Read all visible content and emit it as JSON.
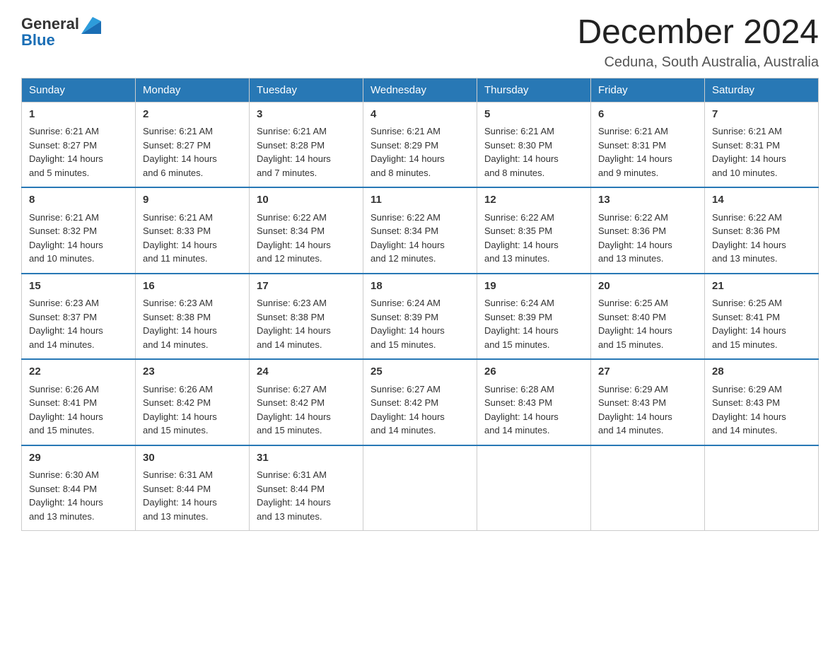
{
  "header": {
    "logo_general": "General",
    "logo_blue": "Blue",
    "month_title": "December 2024",
    "location": "Ceduna, South Australia, Australia"
  },
  "days_of_week": [
    "Sunday",
    "Monday",
    "Tuesday",
    "Wednesday",
    "Thursday",
    "Friday",
    "Saturday"
  ],
  "weeks": [
    [
      {
        "day": "1",
        "sunrise": "6:21 AM",
        "sunset": "8:27 PM",
        "daylight": "14 hours and 5 minutes."
      },
      {
        "day": "2",
        "sunrise": "6:21 AM",
        "sunset": "8:27 PM",
        "daylight": "14 hours and 6 minutes."
      },
      {
        "day": "3",
        "sunrise": "6:21 AM",
        "sunset": "8:28 PM",
        "daylight": "14 hours and 7 minutes."
      },
      {
        "day": "4",
        "sunrise": "6:21 AM",
        "sunset": "8:29 PM",
        "daylight": "14 hours and 8 minutes."
      },
      {
        "day": "5",
        "sunrise": "6:21 AM",
        "sunset": "8:30 PM",
        "daylight": "14 hours and 8 minutes."
      },
      {
        "day": "6",
        "sunrise": "6:21 AM",
        "sunset": "8:31 PM",
        "daylight": "14 hours and 9 minutes."
      },
      {
        "day": "7",
        "sunrise": "6:21 AM",
        "sunset": "8:31 PM",
        "daylight": "14 hours and 10 minutes."
      }
    ],
    [
      {
        "day": "8",
        "sunrise": "6:21 AM",
        "sunset": "8:32 PM",
        "daylight": "14 hours and 10 minutes."
      },
      {
        "day": "9",
        "sunrise": "6:21 AM",
        "sunset": "8:33 PM",
        "daylight": "14 hours and 11 minutes."
      },
      {
        "day": "10",
        "sunrise": "6:22 AM",
        "sunset": "8:34 PM",
        "daylight": "14 hours and 12 minutes."
      },
      {
        "day": "11",
        "sunrise": "6:22 AM",
        "sunset": "8:34 PM",
        "daylight": "14 hours and 12 minutes."
      },
      {
        "day": "12",
        "sunrise": "6:22 AM",
        "sunset": "8:35 PM",
        "daylight": "14 hours and 13 minutes."
      },
      {
        "day": "13",
        "sunrise": "6:22 AM",
        "sunset": "8:36 PM",
        "daylight": "14 hours and 13 minutes."
      },
      {
        "day": "14",
        "sunrise": "6:22 AM",
        "sunset": "8:36 PM",
        "daylight": "14 hours and 13 minutes."
      }
    ],
    [
      {
        "day": "15",
        "sunrise": "6:23 AM",
        "sunset": "8:37 PM",
        "daylight": "14 hours and 14 minutes."
      },
      {
        "day": "16",
        "sunrise": "6:23 AM",
        "sunset": "8:38 PM",
        "daylight": "14 hours and 14 minutes."
      },
      {
        "day": "17",
        "sunrise": "6:23 AM",
        "sunset": "8:38 PM",
        "daylight": "14 hours and 14 minutes."
      },
      {
        "day": "18",
        "sunrise": "6:24 AM",
        "sunset": "8:39 PM",
        "daylight": "14 hours and 15 minutes."
      },
      {
        "day": "19",
        "sunrise": "6:24 AM",
        "sunset": "8:39 PM",
        "daylight": "14 hours and 15 minutes."
      },
      {
        "day": "20",
        "sunrise": "6:25 AM",
        "sunset": "8:40 PM",
        "daylight": "14 hours and 15 minutes."
      },
      {
        "day": "21",
        "sunrise": "6:25 AM",
        "sunset": "8:41 PM",
        "daylight": "14 hours and 15 minutes."
      }
    ],
    [
      {
        "day": "22",
        "sunrise": "6:26 AM",
        "sunset": "8:41 PM",
        "daylight": "14 hours and 15 minutes."
      },
      {
        "day": "23",
        "sunrise": "6:26 AM",
        "sunset": "8:42 PM",
        "daylight": "14 hours and 15 minutes."
      },
      {
        "day": "24",
        "sunrise": "6:27 AM",
        "sunset": "8:42 PM",
        "daylight": "14 hours and 15 minutes."
      },
      {
        "day": "25",
        "sunrise": "6:27 AM",
        "sunset": "8:42 PM",
        "daylight": "14 hours and 14 minutes."
      },
      {
        "day": "26",
        "sunrise": "6:28 AM",
        "sunset": "8:43 PM",
        "daylight": "14 hours and 14 minutes."
      },
      {
        "day": "27",
        "sunrise": "6:29 AM",
        "sunset": "8:43 PM",
        "daylight": "14 hours and 14 minutes."
      },
      {
        "day": "28",
        "sunrise": "6:29 AM",
        "sunset": "8:43 PM",
        "daylight": "14 hours and 14 minutes."
      }
    ],
    [
      {
        "day": "29",
        "sunrise": "6:30 AM",
        "sunset": "8:44 PM",
        "daylight": "14 hours and 13 minutes."
      },
      {
        "day": "30",
        "sunrise": "6:31 AM",
        "sunset": "8:44 PM",
        "daylight": "14 hours and 13 minutes."
      },
      {
        "day": "31",
        "sunrise": "6:31 AM",
        "sunset": "8:44 PM",
        "daylight": "14 hours and 13 minutes."
      },
      null,
      null,
      null,
      null
    ]
  ],
  "labels": {
    "sunrise": "Sunrise:",
    "sunset": "Sunset:",
    "daylight": "Daylight:"
  }
}
